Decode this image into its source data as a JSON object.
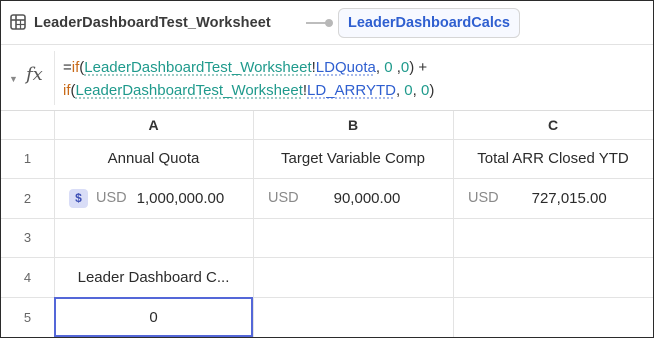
{
  "topbar": {
    "sheet_icon": "grid-icon",
    "sheet_title": "LeaderDashboardTest_Worksheet",
    "calc_tab_label": "LeaderDashboardCalcs"
  },
  "formula_bar": {
    "toggle_icon": "chevron-down-icon",
    "fx_label": "fx",
    "line1": {
      "eq": "=",
      "fn": "if",
      "open": "(",
      "ref": "LeaderDashboardTest_Worksheet",
      "bang": "!",
      "range": "LDQuota",
      "args": ", ",
      "n1": "0",
      "sep1": " ,",
      "n2": "0",
      "close": ") +"
    },
    "line2": {
      "fn": "if",
      "open": "(",
      "ref": "LeaderDashboardTest_Worksheet",
      "bang": "!",
      "range": "LD_ARRYTD",
      "args": ", ",
      "n1": "0",
      "sep1": ", ",
      "n2": "0",
      "close": ")"
    }
  },
  "grid": {
    "columns": [
      "A",
      "B",
      "C"
    ],
    "rows": [
      "1",
      "2",
      "3",
      "4",
      "5"
    ],
    "cells": {
      "a1": "Annual Quota",
      "b1": "Target Variable Comp",
      "c1": "Total ARR Closed YTD",
      "a2": {
        "badge": "$",
        "currency": "USD",
        "value": "1,000,000.00"
      },
      "b2": {
        "currency": "USD",
        "value": "90,000.00"
      },
      "c2": {
        "currency": "USD",
        "value": "727,015.00"
      },
      "a4": "Leader Dashboard C...",
      "a5": "0"
    },
    "selected_cell": "A5",
    "accent_color": "#5467d8"
  }
}
